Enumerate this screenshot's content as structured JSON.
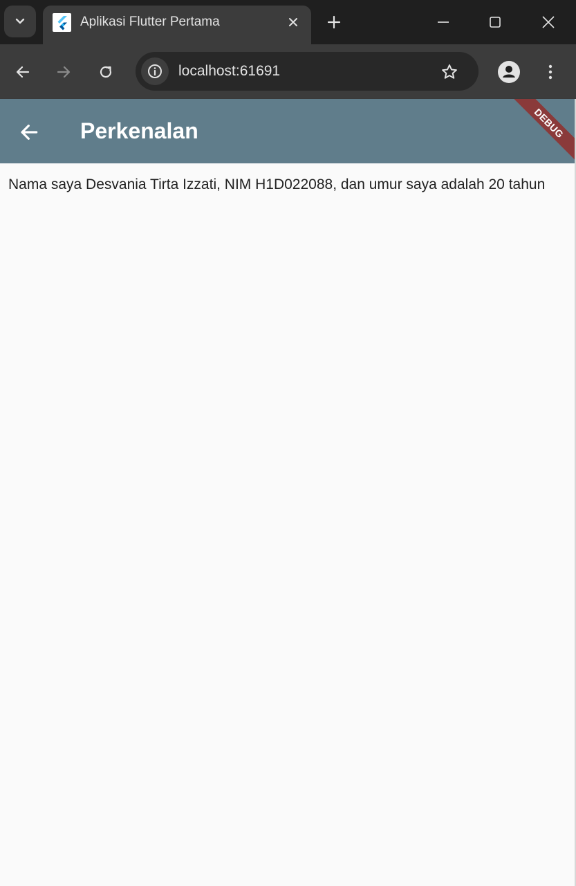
{
  "browser": {
    "tab": {
      "title": "Aplikasi Flutter Pertama",
      "favicon": "flutter-logo-icon"
    },
    "address_bar": {
      "url": "localhost:61691"
    },
    "icons": {
      "tab_search": "chevron-down-icon",
      "close_tab": "close-icon",
      "new_tab": "plus-icon",
      "minimize": "minimize-icon",
      "maximize": "maximize-icon",
      "close_window": "close-icon",
      "back": "arrow-left-icon",
      "forward": "arrow-right-icon",
      "reload": "reload-icon",
      "site_info": "info-icon",
      "bookmark": "star-icon",
      "profile": "profile-icon",
      "menu": "kebab-menu-icon"
    }
  },
  "app": {
    "appbar": {
      "title": "Perkenalan",
      "back_icon": "arrow-left-icon",
      "color": "#607d8b"
    },
    "debug_banner": "DEBUG",
    "body": {
      "text": "Nama saya Desvania Tirta Izzati, NIM H1D022088, dan umur saya adalah 20 tahun"
    }
  }
}
